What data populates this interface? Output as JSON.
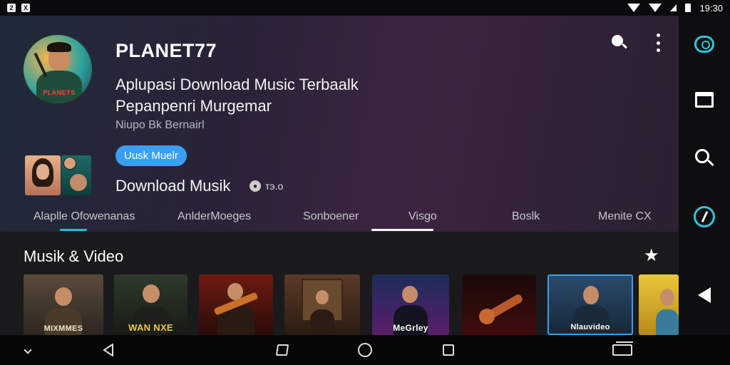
{
  "status_bar": {
    "left_icons": [
      "2",
      "X"
    ],
    "time": "19:30"
  },
  "hero": {
    "avatar_logo_text": "PLANETS",
    "title": "PLANET77",
    "headline_line1": "Aplupasi Download Music Terbaalk",
    "headline_line2": "Pepanpenri Murgemar",
    "subline": "Niupo Bk Bernairl",
    "pill_label": "Uusk Muelr",
    "download_label": "Download Musik",
    "count": "тэ.о"
  },
  "tabs": [
    {
      "label": "Alaplle Ofowenanas",
      "active": true
    },
    {
      "label": "AnlderMoeges",
      "active": false
    },
    {
      "label": "Sonboener",
      "active": false
    },
    {
      "label": "Visgo",
      "active": true
    },
    {
      "label": "Boslk",
      "active": false
    },
    {
      "label": "Menite CX",
      "active": false
    }
  ],
  "tab_colors": {
    "accent": "#30b8d0",
    "selected": "#ffffff"
  },
  "section": {
    "title": "Musik & Video"
  },
  "cards": [
    {
      "caption": "MIXMMES",
      "top": "#5a4a3a",
      "bottom": "#2b2620"
    },
    {
      "caption": "WAN NXE",
      "top": "#2d3a2a",
      "bottom": "#171a14"
    },
    {
      "caption": "",
      "top": "#6e1a12",
      "bottom": "#2a0b08"
    },
    {
      "caption": "",
      "top": "#5b3a28",
      "bottom": "#2a1b12"
    },
    {
      "caption": "MeGrley",
      "top": "#1c2c5a",
      "bottom": "#5a1e6a"
    },
    {
      "caption": "",
      "top": "#1a0a0a",
      "bottom": "#400c0c"
    },
    {
      "caption": "Nlauvideo",
      "top": "#2a4a6a",
      "bottom": "#16283a"
    },
    {
      "caption": "",
      "top": "#e8c83a",
      "bottom": "#b88a1a"
    }
  ],
  "colors": {
    "accent_blue": "#3a9ff0",
    "rail_accent": "#30c6d8"
  }
}
